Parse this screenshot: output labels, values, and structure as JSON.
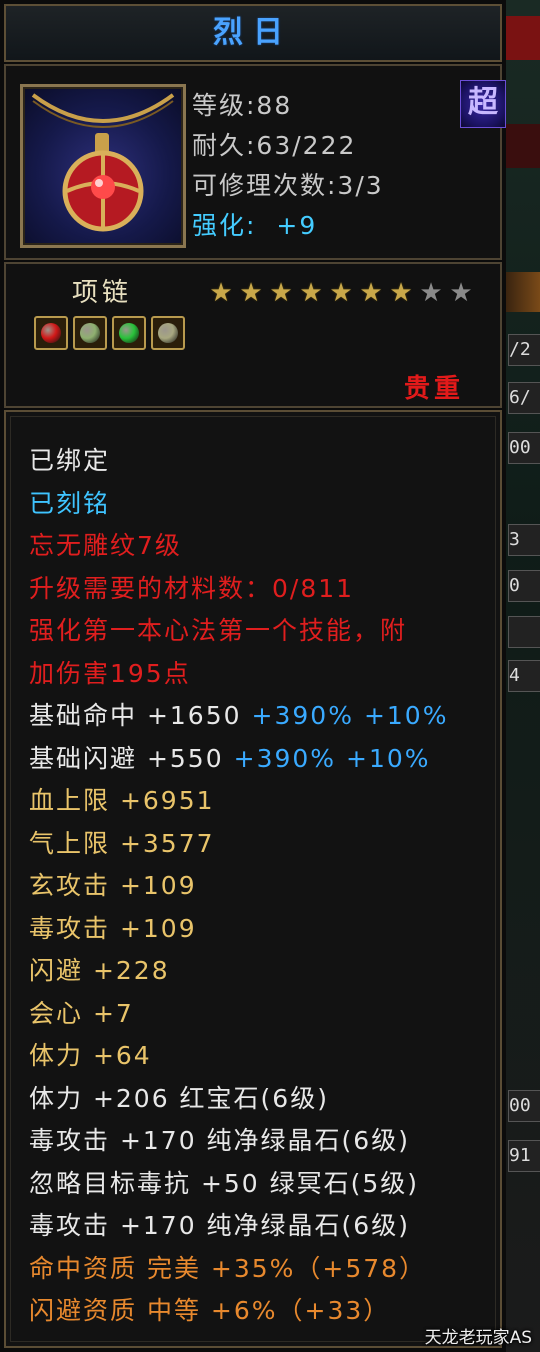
{
  "item": {
    "title": "烈日",
    "level": "等级:88",
    "durability": "耐久:63/222",
    "repair": "可修理次数:3/3",
    "enhance_label": "强化:",
    "enhance_value": "+9",
    "badge": "超",
    "type": "项链",
    "stars_total": 9,
    "stars_lit": 7,
    "rarity": "贵重"
  },
  "gem_slots": [
    {
      "color": "#d21818",
      "name": "red-gem"
    },
    {
      "color": "#8fb070",
      "name": "jade-gem"
    },
    {
      "color": "#29c23a",
      "name": "green-gem"
    },
    {
      "color": "#a8a880",
      "name": "jade-gem"
    }
  ],
  "details": [
    {
      "parts": [
        {
          "text": "已绑定",
          "color": "white"
        }
      ]
    },
    {
      "parts": [
        {
          "text": "已刻铭",
          "color": "cyan"
        }
      ]
    },
    {
      "parts": [
        {
          "text": "忘无雕纹7级",
          "color": "red"
        }
      ]
    },
    {
      "parts": [
        {
          "text": "升级需要的材料数：0/811",
          "color": "red"
        }
      ]
    },
    {
      "parts": [
        {
          "text": "强化第一本心法第一个技能，附",
          "color": "red"
        }
      ]
    },
    {
      "parts": [
        {
          "text": "加伤害195点",
          "color": "red"
        }
      ]
    },
    {
      "parts": [
        {
          "text": "基础命中 +1650",
          "color": "white"
        },
        {
          "text": "+390%",
          "color": "blue"
        },
        {
          "text": "+10%",
          "color": "blue"
        }
      ]
    },
    {
      "parts": [
        {
          "text": "基础闪避 +550",
          "color": "white"
        },
        {
          "text": "+390%",
          "color": "blue"
        },
        {
          "text": "+10%",
          "color": "blue"
        }
      ]
    },
    {
      "parts": [
        {
          "text": "血上限 +6951",
          "color": "gold"
        }
      ]
    },
    {
      "parts": [
        {
          "text": "气上限 +3577",
          "color": "gold"
        }
      ]
    },
    {
      "parts": [
        {
          "text": "玄攻击 +109",
          "color": "gold"
        }
      ]
    },
    {
      "parts": [
        {
          "text": "毒攻击 +109",
          "color": "gold"
        }
      ]
    },
    {
      "parts": [
        {
          "text": "闪避 +228",
          "color": "gold"
        }
      ]
    },
    {
      "parts": [
        {
          "text": "会心 +7",
          "color": "gold"
        }
      ]
    },
    {
      "parts": [
        {
          "text": "体力 +64",
          "color": "gold"
        }
      ]
    },
    {
      "parts": [
        {
          "text": "体力 +206 红宝石(6级)",
          "color": "white"
        }
      ]
    },
    {
      "parts": [
        {
          "text": "毒攻击 +170 纯净绿晶石(6级)",
          "color": "white"
        }
      ]
    },
    {
      "parts": [
        {
          "text": "忽略目标毒抗 +50 绿冥石(5级)",
          "color": "white"
        }
      ]
    },
    {
      "parts": [
        {
          "text": "毒攻击 +170 纯净绿晶石(6级)",
          "color": "white"
        }
      ]
    },
    {
      "parts": [
        {
          "text": "命中资质  完美 +35%（+578）",
          "color": "orange"
        }
      ]
    },
    {
      "parts": [
        {
          "text": "闪避资质  中等 +6%（+33）",
          "color": "orange"
        }
      ]
    }
  ],
  "background_cells": [
    "/2",
    "6/",
    "00",
    "3",
    "0",
    "",
    "4",
    "00",
    "91"
  ],
  "watermark": "天龙老玩家AS"
}
